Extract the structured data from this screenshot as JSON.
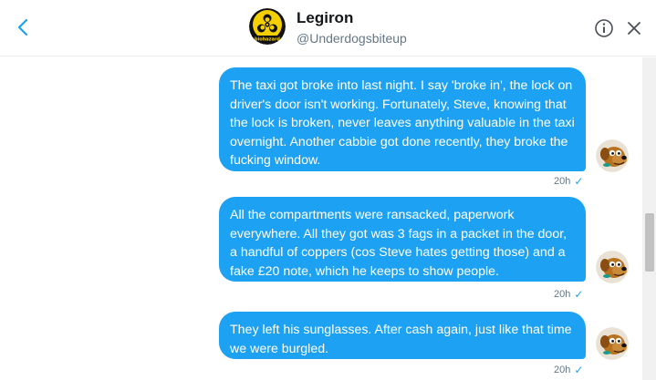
{
  "header": {
    "title": "Legiron",
    "handle": "@Underdogsbiteup",
    "avatar_text": "biohazard"
  },
  "messages": [
    {
      "text": "The taxi got broke into last night. I say 'broke in', the lock on driver's door isn't working. Fortunately, Steve, knowing that the lock is broken, never leaves anything valuable in the taxi overnight. Another cabbie got done recently, they broke the fucking window.",
      "time": "20h"
    },
    {
      "text": "All the compartments were ransacked, paperwork everywhere. All they got was 3 fags in a packet in the door, a handful of coppers (cos Steve hates getting those) and a fake £20 note, which he keeps to show people.",
      "time": "20h"
    },
    {
      "text": "They left his sunglasses. After cash again, just like that time we were burgled.",
      "time": "20h"
    }
  ],
  "colors": {
    "bubble": "#1da1f2",
    "read_check": "#1da1f2",
    "meta_text": "#657786"
  },
  "icons": {
    "back": "chevron-left-icon",
    "info": "info-icon",
    "close": "close-icon",
    "read": "checkmark-icon"
  }
}
